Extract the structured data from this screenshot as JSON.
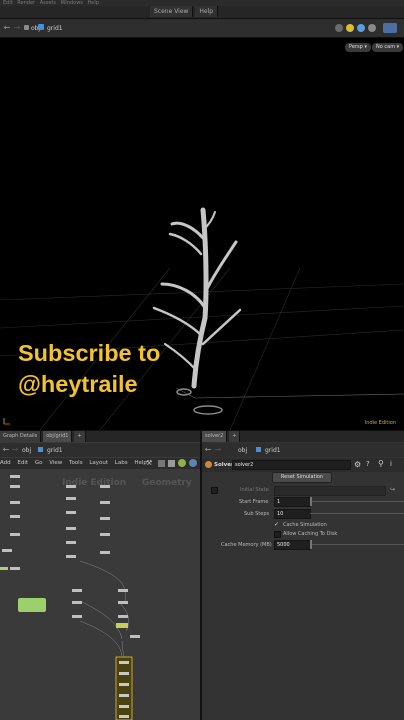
{
  "menubar": [
    "Edit",
    "Render",
    "Assets",
    "Windows",
    "Help"
  ],
  "top_tabs": [
    "Scene View",
    "Help"
  ],
  "path": {
    "context": "obj",
    "node": "grid1"
  },
  "viewport": {
    "persp_label": "Persp",
    "cam_label": "No cam",
    "edition_label": "Indie Edition",
    "overlay_line1": "Subscribe to",
    "overlay_line2": "@heytraile"
  },
  "network": {
    "tabs": [
      "Graph Details",
      "obj/grid1"
    ],
    "path": {
      "context": "obj",
      "node": "grid1"
    },
    "menu": [
      "Add",
      "Edit",
      "Go",
      "View",
      "Tools",
      "Layout",
      "Labs",
      "Help"
    ],
    "watermark_left": "Indie Edition",
    "watermark_right": "Geometry"
  },
  "parms": {
    "tabs": [
      "solver2"
    ],
    "path": {
      "context": "obj",
      "node": "grid1"
    },
    "node_type": "Solver",
    "node_name": "solver2",
    "reset_button": "Reset Simulation",
    "initial_state_label": "Initial State",
    "start_frame_label": "Start Frame",
    "start_frame_value": "1",
    "sub_steps_label": "Sub Steps",
    "sub_steps_value": "10",
    "cache_sim_label": "Cache Simulation",
    "cache_sim_checked": true,
    "allow_caching_label": "Allow Caching To Disk",
    "allow_caching_checked": false,
    "cache_memory_label": "Cache Memory (MB)",
    "cache_memory_value": "5000"
  },
  "colors": {
    "accent_yellow": "#f2c230",
    "viewport_bg": "#000000",
    "panel_bg": "#3a3a3a"
  }
}
